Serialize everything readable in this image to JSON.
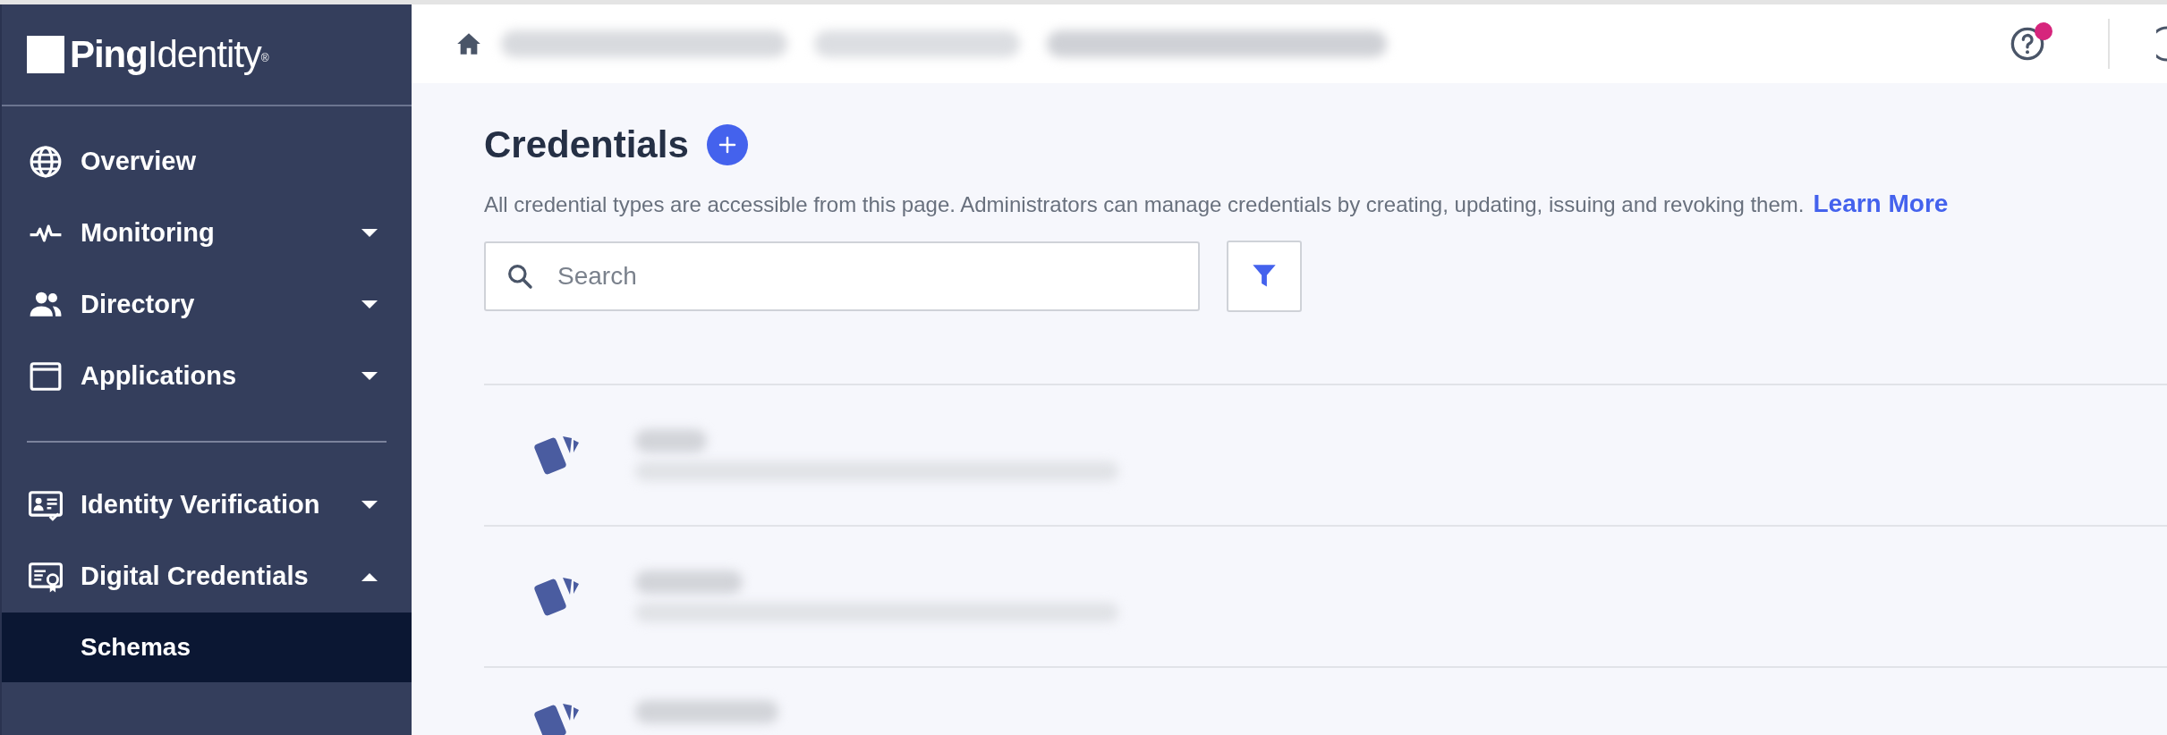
{
  "logo": {
    "strong": "Ping",
    "light": "Identity",
    "mark": "®"
  },
  "sidebar": {
    "groups": [
      [
        {
          "label": "Overview"
        },
        {
          "label": "Monitoring",
          "expanded": false
        },
        {
          "label": "Directory",
          "expanded": false
        },
        {
          "label": "Applications",
          "expanded": false
        }
      ],
      [
        {
          "label": "Identity Verification",
          "expanded": false
        },
        {
          "label": "Digital Credentials",
          "expanded": true,
          "children": [
            {
              "label": "Schemas",
              "selected": true
            }
          ]
        }
      ]
    ]
  },
  "header": {
    "help": {
      "notification": true
    }
  },
  "page": {
    "title": "Credentials",
    "description": "All credential types are accessible from this page. Administrators can manage credentials by creating, updating, issuing and revoking them.",
    "link": "Learn More",
    "search": {
      "placeholder": "Search"
    }
  },
  "credentials": [
    {
      "redacted": true
    },
    {
      "redacted": true
    },
    {
      "redacted": true,
      "cut_off": true
    }
  ]
}
